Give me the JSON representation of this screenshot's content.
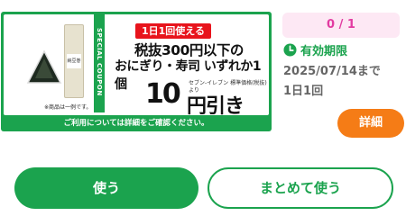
{
  "coupon": {
    "badge": "1日1回使える",
    "line1": "税抜300円以下の",
    "line2": "おにぎり・寿司 いずれか1個",
    "amount": "10",
    "amount_unit": "円引き",
    "small_note": "セブン‐イレブン 標準価格(税抜)より",
    "side_text": "SPECIAL COUPON",
    "product_note": "※商品は一例です。",
    "footer": "ご利用については詳細をご確認ください。",
    "package_label": "納豆巻"
  },
  "status": {
    "count": "0 / 1",
    "expiry_label": "有効期限",
    "expiry_date": "2025/07/14まで",
    "expiry_note": "1日1回",
    "detail_button": "詳細"
  },
  "actions": {
    "use": "使う",
    "use_all": "まとめて使う"
  },
  "colors": {
    "green": "#1ba34e",
    "orange": "#f57c16",
    "pink": "#e23ba1",
    "red": "#e8141c"
  }
}
